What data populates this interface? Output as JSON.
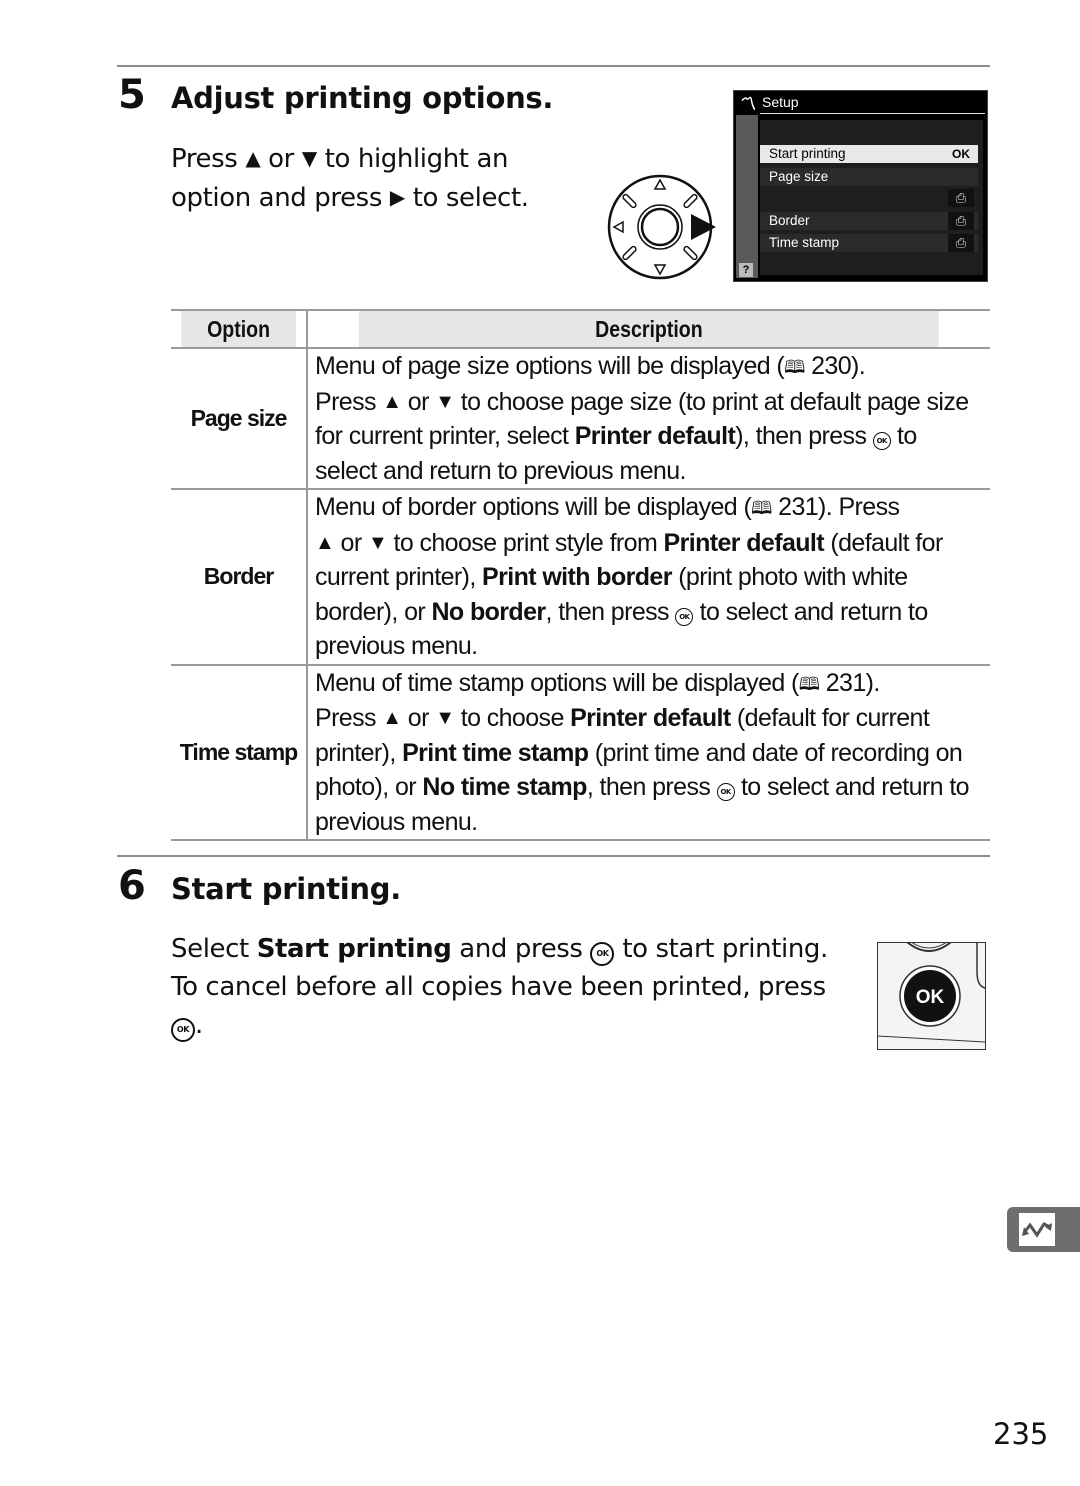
{
  "step5": {
    "number": "5",
    "title": "Adjust printing options.",
    "instruction": {
      "press": "Press",
      "up_symbol": "▲",
      "or": "or",
      "down_symbol": "▼",
      "to_highlight": "to highlight an",
      "line2_start": "option and press",
      "right_symbol": "▶",
      "line2_end": "to select."
    },
    "multi_selector_icon": "multi-selector-right-icon",
    "lcd": {
      "title": "Setup",
      "logo_icon": "pictbridge-icon",
      "help_label": "?",
      "items": [
        {
          "label": "Start printing",
          "icon": "OK",
          "selected": true
        },
        {
          "label": "Page size",
          "icon": "",
          "selected": false
        },
        {
          "label": "",
          "icon": "⎙",
          "selected": false
        },
        {
          "label": "Border",
          "icon": "⎙",
          "selected": false
        },
        {
          "label": "Time stamp",
          "icon": "⎙",
          "selected": false
        }
      ]
    }
  },
  "table": {
    "headers": [
      "Option",
      "Description"
    ],
    "rows": [
      {
        "option": "Page size",
        "description": {
          "s1": "Menu of page size options will be displayed (",
          "book": "🕮",
          "page": " 230).",
          "s2": "Press ",
          "s3": " or ",
          "s4": " to choose page size (to print at default page size for current printer, select ",
          "bold1": "Printer default",
          "s5": "), then press ",
          "s6": " to select and return to previous menu."
        }
      },
      {
        "option": "Border",
        "description": {
          "s1": "Menu of border options will be displayed (",
          "book": "🕮",
          "page": " 231).  Press",
          "s2": " or ",
          "s3": " to choose print style from ",
          "bold1": "Printer default",
          "s4": " (default for current printer), ",
          "bold2": "Print with border",
          "s5": " (print photo with white border), or ",
          "bold3": "No border",
          "s6": ", then press ",
          "s7": " to select and return to previous menu."
        }
      },
      {
        "option": "Time stamp",
        "description": {
          "s1": "Menu of time stamp options will be displayed (",
          "book": "🕮",
          "page": " 231).",
          "s2": "Press ",
          "s3": " or ",
          "s4": " to choose ",
          "bold1": "Printer default",
          "s5": " (default for current printer), ",
          "bold2": "Print time stamp",
          "s6": " (print time and date of recording on photo), or ",
          "bold3": "No time stamp",
          "s7": ", then press ",
          "s8": " to select and return to previous menu."
        }
      }
    ]
  },
  "step6": {
    "number": "6",
    "title": "Start printing.",
    "line1_a": "Select ",
    "line1_bold": "Start printing",
    "line1_b": " and press ",
    "line1_c": " to start printing.",
    "line2": "To cancel before all copies have been printed, press",
    "line3_end": ".",
    "ok_button_label": "OK"
  },
  "symbols": {
    "up": "▲",
    "down": "▼",
    "ok_glyph": "OK"
  },
  "side_tab": {
    "icon": "pictbridge-connection-icon"
  },
  "page_number": "235"
}
